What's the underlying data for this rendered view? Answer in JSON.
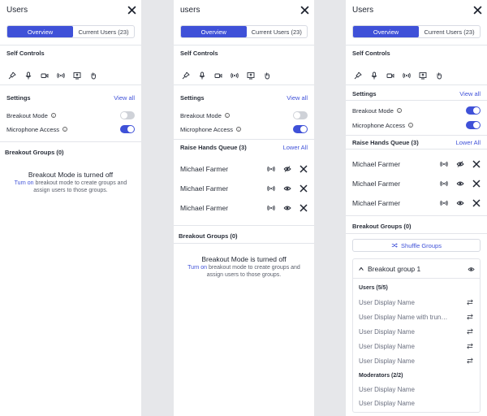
{
  "panels": [
    {
      "title": "Users",
      "tabs": {
        "overview": "Overview",
        "current": "Current Users (23)"
      },
      "self_controls": "Self Controls",
      "settings": {
        "label": "Settings",
        "view_all": "View all",
        "breakout_mode": "Breakout Mode",
        "breakout_on": false,
        "mic_access": "Microphone Access",
        "mic_on": true
      },
      "breakout_groups": "Breakout Groups (0)",
      "empty": {
        "title": "Breakout Mode is turned off",
        "turn_on": "Turn on",
        "rest": " breakout mode to create groups and assign users to those groups."
      }
    },
    {
      "title": "users",
      "tabs": {
        "overview": "Overview",
        "current": "Current Users (23)"
      },
      "self_controls": "Self Controls",
      "settings": {
        "label": "Settings",
        "view_all": "View all",
        "breakout_mode": "Breakout Mode",
        "breakout_on": false,
        "mic_access": "Microphone Access",
        "mic_on": true
      },
      "raise_hands": {
        "label": "Raise Hands Queue (3)",
        "lower_all": "Lower All",
        "people": [
          "Michael Farmer",
          "Michael Farmer",
          "Michael Farmer"
        ]
      },
      "breakout_groups": "Breakout Groups (0)",
      "empty": {
        "title": "Breakout Mode is turned off",
        "turn_on": "Turn on",
        "rest": " breakout mode to create groups and assign users to those groups."
      }
    },
    {
      "title": "Users",
      "tabs": {
        "overview": "Overview",
        "current": "Current Users (23)"
      },
      "self_controls": "Self Controls",
      "settings": {
        "label": "Settings",
        "view_all": "View all",
        "breakout_mode": "Breakout Mode",
        "breakout_on": true,
        "mic_access": "Microphone Access",
        "mic_on": true
      },
      "raise_hands": {
        "label": "Raise Hands Queue (3)",
        "lower_all": "Lower All",
        "people": [
          "Michael Farmer",
          "Michael Farmer",
          "Michael Farmer"
        ]
      },
      "breakout_groups": "Breakout Groups (0)",
      "shuffle": "Shuffle Groups",
      "group": {
        "name": "Breakout group 1",
        "users_label": "Users (5/5)",
        "users": [
          "User Display Name",
          "User Display Name with trun…",
          "User Display Name",
          "User Display Name",
          "User Display Name"
        ],
        "moderators_label": "Moderators (2/2)",
        "moderators": [
          "User Display Name",
          "User Display Name"
        ]
      }
    }
  ],
  "icons": [
    "pin-icon",
    "microphone-icon",
    "camera-icon",
    "broadcast-icon",
    "screen-share-icon",
    "raise-hand-icon"
  ],
  "colors": {
    "accent": "#3f51d8",
    "toggle_off": "#cfd2d8"
  }
}
